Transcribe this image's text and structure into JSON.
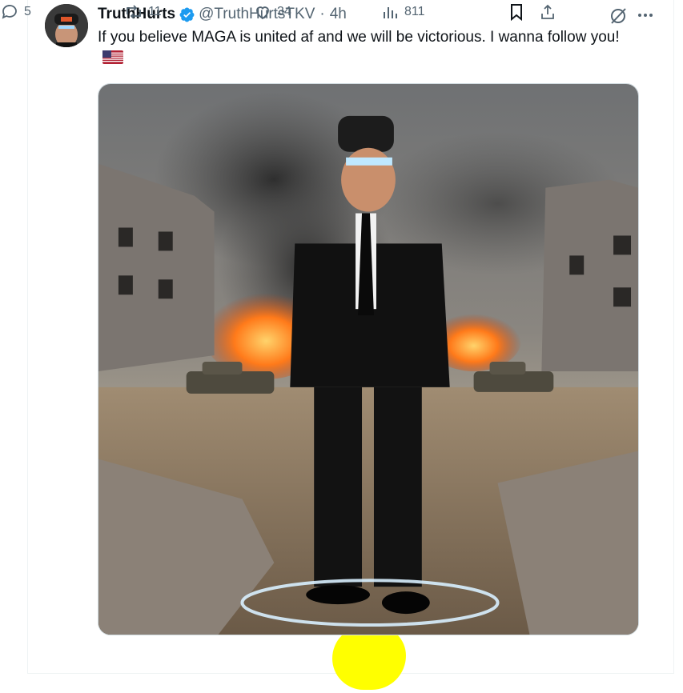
{
  "post": {
    "author_name": "TruthHurts",
    "handle": "@TruthHurtsTKV",
    "separator": "·",
    "time": "4h",
    "text": "If you believe MAGA is united af and we will be victorious. I wanna follow you!",
    "flag_icon": "us-flag-icon",
    "verified_icon": "verified-badge-icon"
  },
  "actions": {
    "replies": "5",
    "reposts": "11",
    "likes": "34",
    "views": "811"
  },
  "colors": {
    "text": "#0f1419",
    "muted": "#536471",
    "verified": "#1d9bf0",
    "highlight": "#ffff00",
    "border": "#eff3f4"
  }
}
